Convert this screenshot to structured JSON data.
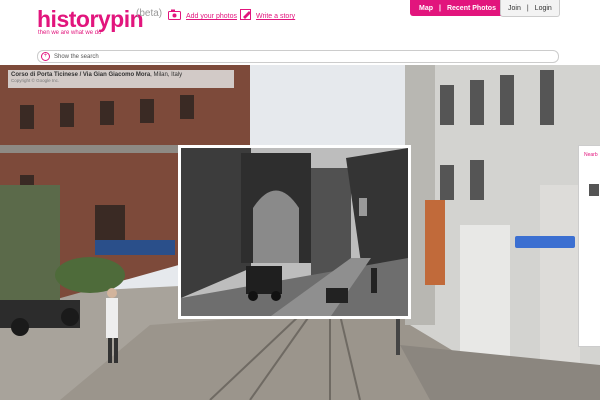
{
  "header": {
    "logo_text": "historypin",
    "beta": "(beta)",
    "tagline": "then we are what we do",
    "add_photos": "Add your photos",
    "write_story": "Write a story",
    "nav_tab_map": "Map",
    "nav_sep": "|",
    "nav_tab_recent": "Recent Photos",
    "join": "Join",
    "auth_sep": "|",
    "login": "Login"
  },
  "search": {
    "label": "Show the search"
  },
  "location": {
    "address": "Corso di Porta Ticinese / Via Gian Giacomo Mora",
    "city": ", Milan, Italy",
    "copyright": "Copyright © Google Inc."
  },
  "sidepanel": {
    "nearby_label": "Nearb"
  },
  "colors": {
    "brand": "#e2157d"
  },
  "icons": [
    "camera-icon",
    "pencil-icon",
    "plus-icon",
    "nav-arrow-icon"
  ]
}
